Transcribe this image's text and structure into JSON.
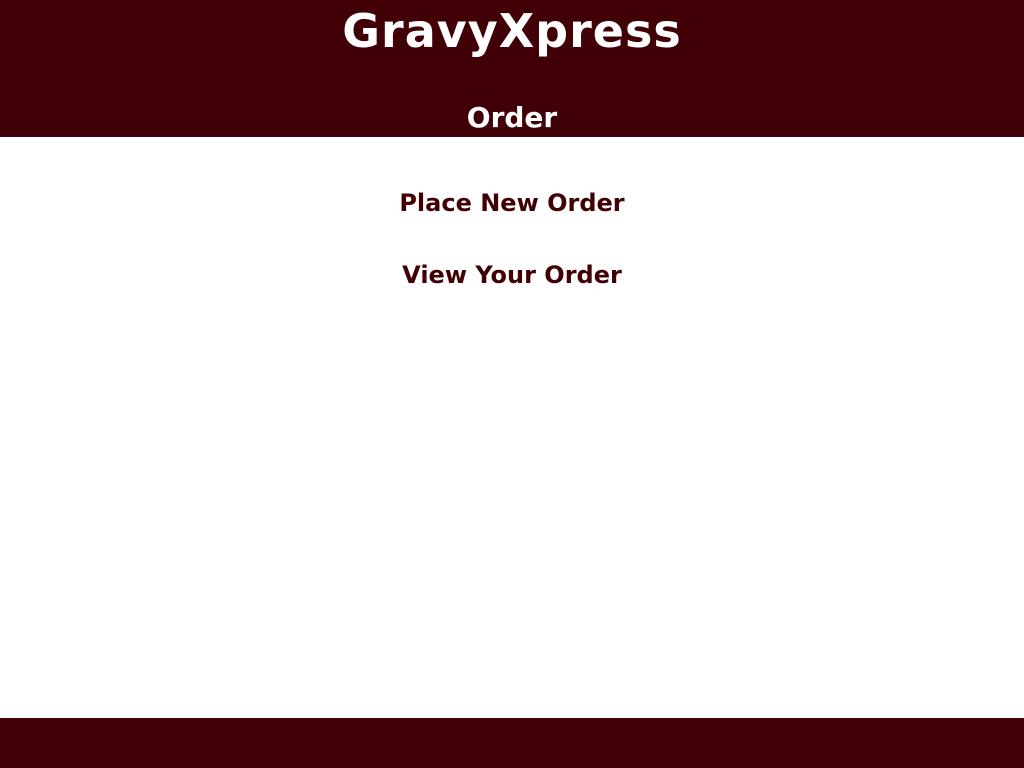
{
  "colors": {
    "brand": "#400005",
    "background": "#ffffff",
    "header_text": "#ffffff",
    "link_text": "#400005"
  },
  "header": {
    "brand_name": "GravyXpress",
    "page_title": "Order"
  },
  "menu": {
    "items": [
      {
        "label": "Place New Order"
      },
      {
        "label": "View Your Order"
      }
    ]
  }
}
